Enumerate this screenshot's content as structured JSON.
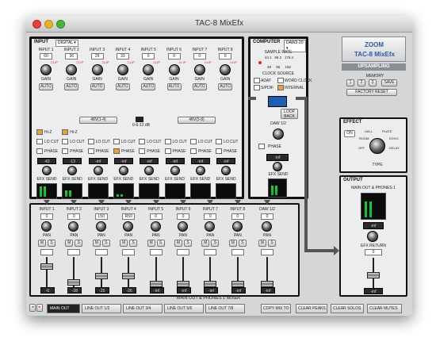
{
  "window": {
    "title": "TAC-8 MixEfx"
  },
  "input": {
    "title": "INPUT",
    "mode": "DIGITAL",
    "channels": [
      {
        "name": "INPUT 1",
        "value": "60"
      },
      {
        "name": "INPUT 2",
        "value": "36"
      },
      {
        "name": "INPUT 3",
        "value": "29"
      },
      {
        "name": "INPUT 4",
        "value": "33"
      },
      {
        "name": "INPUT 5",
        "value": "0"
      },
      {
        "name": "INPUT 6",
        "value": "0"
      },
      {
        "name": "INPUT 7",
        "value": "0"
      },
      {
        "name": "INPUT 8",
        "value": "0"
      }
    ],
    "clip": "CLIP",
    "gain": "GAIN",
    "auto": "AUTO",
    "phantom_a": "48V(1-4)",
    "phantom_b": "48V(5-8)",
    "pad_label": "0-6-12 dB",
    "hiz": "Hi-Z",
    "locut": "LO CUT",
    "phase": "PHASE",
    "send_values": [
      "-43",
      "-13",
      "-inf",
      "-inf",
      "-inf",
      "-inf",
      "-inf",
      "-inf"
    ],
    "efx_send": "EFX SEND",
    "meter_scale": [
      "0",
      "-6",
      "-12",
      "-18",
      "-24",
      "-48"
    ]
  },
  "computer": {
    "title": "COMPUTER",
    "select": "DAW3-20",
    "sample_rate": "SAMPLE RATE",
    "rates": [
      "44.1",
      "88.2",
      "176.4",
      "48",
      "96",
      "192"
    ],
    "clock_source": "CLOCK SOURCE",
    "clocks": [
      "ADAT",
      "WORD CLOCK",
      "S/PDIF",
      "INTERNAL"
    ],
    "loop_back": "LOOP BACK",
    "daw": "DAW 1/2",
    "send": "-inf",
    "efx_send": "EFX SEND"
  },
  "brand": {
    "logo": "ZOOM",
    "model": "TAC-8 MixEfx",
    "upsampling": "UPSAMPLING",
    "memory": "MEMORY",
    "slots": [
      "1",
      "2",
      "3"
    ],
    "save": "SAVE",
    "factory_reset": "FACTORY RESET"
  },
  "effect": {
    "title": "EFFECT",
    "on": "ON",
    "type": "TYPE",
    "types": [
      "HALL",
      "ROOM",
      "PLATE",
      "ECHO",
      "DELAY",
      "OFF"
    ]
  },
  "output": {
    "title": "OUTPUT",
    "bus": "MAIN OUT & PHONES 1",
    "send_value": "-inf",
    "efx_return": "EFX RETURN",
    "fader": "0",
    "fader_value": "-inf"
  },
  "mixer": {
    "title": "MAIN OUT & PHONES 1 MIXER",
    "strips": [
      {
        "name": "INPUT 1",
        "pan": "0",
        "value": "-6"
      },
      {
        "name": "INPUT 2",
        "pan": "0",
        "value": "-38"
      },
      {
        "name": "INPUT 3",
        "pan": "L50",
        "value": "-25"
      },
      {
        "name": "INPUT 4",
        "pan": "R50",
        "value": "-26"
      },
      {
        "name": "INPUT 5",
        "pan": "0",
        "value": "-inf"
      },
      {
        "name": "INPUT 6",
        "pan": "0",
        "value": "-inf"
      },
      {
        "name": "INPUT 7",
        "pan": "0",
        "value": "-inf"
      },
      {
        "name": "INPUT 8",
        "pan": "0",
        "value": "-inf"
      },
      {
        "name": "DAW 1/2",
        "pan": "0",
        "value": "-inf"
      }
    ],
    "pan": "PAN",
    "mute": "M",
    "solo": "S",
    "scale": [
      "+6",
      "0",
      "-6",
      "-12",
      "-24",
      "-48",
      "-∞"
    ]
  },
  "bottom_tabs": [
    "MAIN OUT",
    "LINE OUT 1/2",
    "LINE OUT 3/4",
    "LINE OUT 5/6",
    "LINE OUT 7/8"
  ],
  "bottom_buttons": [
    "COPY MIX TO",
    "CLEAR PEAKS",
    "CLEAR SOLOS",
    "CLEAR MUTES"
  ],
  "colors": {
    "accent": "#e8a33a",
    "meter": "#22cc33",
    "logo_blue": "#2c59a8"
  }
}
